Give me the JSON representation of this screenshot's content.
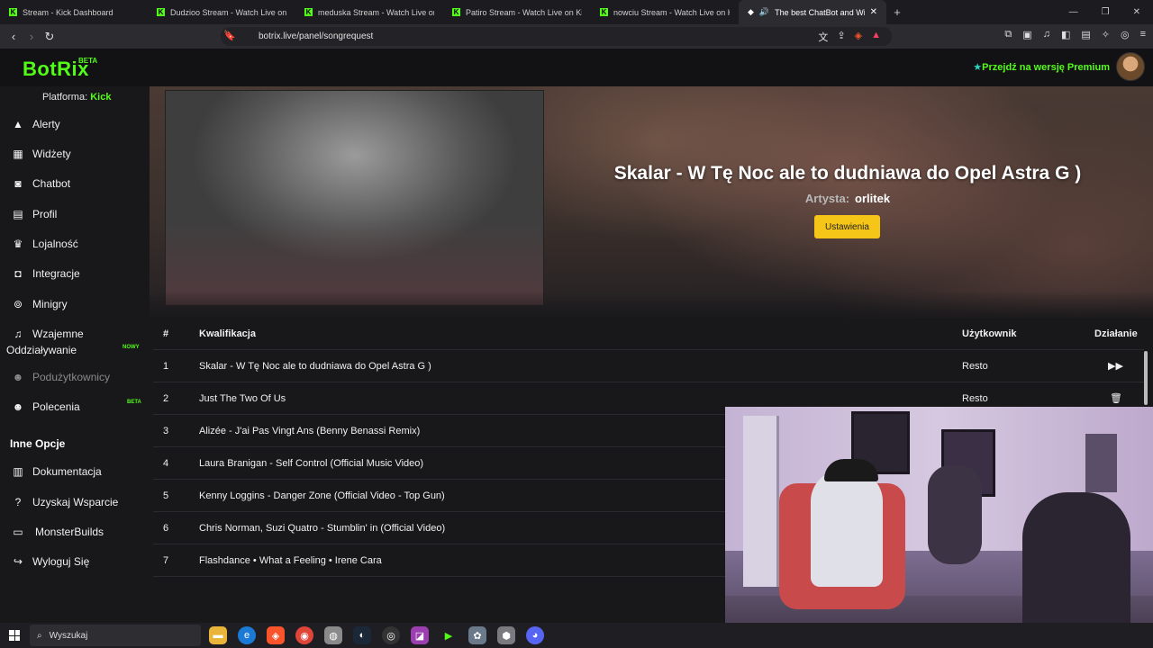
{
  "browser": {
    "tabs": [
      {
        "label": "Stream - Kick Dashboard",
        "kick": true
      },
      {
        "label": "Dudzioo Stream - Watch Live on Kick",
        "kick": true
      },
      {
        "label": "meduska Stream - Watch Live on Kick",
        "kick": true
      },
      {
        "label": "Patiro Stream - Watch Live on Kick",
        "kick": true
      },
      {
        "label": "nowciu Stream - Watch Live on Kick",
        "kick": true
      },
      {
        "label": "The best ChatBot and Widget",
        "kick": false,
        "active": true
      }
    ],
    "url": "botrix.live/panel/songrequest"
  },
  "header": {
    "logo": "BotRix",
    "logo_badge": "BETA",
    "premium_link": "Przejdź na wersję Premium",
    "brand_color": "#53fc18"
  },
  "sidebar": {
    "platform_label": "Platforma:",
    "platform_value": "Kick",
    "items": [
      {
        "label": "Alerty",
        "icon": "warning-icon"
      },
      {
        "label": "Widżety",
        "icon": "grid-icon"
      },
      {
        "label": "Chatbot",
        "icon": "robot-icon"
      },
      {
        "label": "Profil",
        "icon": "id-card-icon"
      },
      {
        "label": "Lojalność",
        "icon": "trophy-icon"
      },
      {
        "label": "Integracje",
        "icon": "plug-icon"
      },
      {
        "label": "Minigry",
        "icon": "gamepad-icon"
      },
      {
        "label": "Wzajemne",
        "label2": "Oddziaływanie",
        "icon": "music-icon",
        "badge": "NOWY"
      },
      {
        "label": "Podużytkownicy",
        "icon": "users-icon",
        "dim": true
      },
      {
        "label": "Polecenia",
        "icon": "users-icon",
        "badge": "BETA"
      }
    ],
    "section_label": "Inne Opcje",
    "other_items": [
      {
        "label": "Dokumentacja",
        "icon": "scroll-icon"
      },
      {
        "label": "Uzyskaj Wsparcie",
        "icon": "question-icon"
      },
      {
        "label": "MonsterBuilds",
        "icon": "laptop-icon"
      },
      {
        "label": "Wyloguj Się",
        "icon": "logout-icon"
      }
    ]
  },
  "now_playing": {
    "title": "Skalar - W Tę Noc ale to dudniawa do Opel Astra G )",
    "artist_label": "Artysta:",
    "artist": "orlitek",
    "settings_button": "Ustawienia"
  },
  "queue": {
    "headers": {
      "num": "#",
      "title": "Kwalifikacja",
      "user": "Użytkownik",
      "action": "Działanie"
    },
    "rows": [
      {
        "num": "1",
        "title": "Skalar - W Tę Noc ale to dudniawa do Opel Astra G )",
        "user": "Resto",
        "action": "skip"
      },
      {
        "num": "2",
        "title": "Just The Two Of Us",
        "user": "Resto",
        "action": "delete"
      },
      {
        "num": "3",
        "title": "Alizée - J'ai Pas Vingt Ans (Benny Benassi Remix)",
        "user": "",
        "action": ""
      },
      {
        "num": "4",
        "title": "Laura Branigan - Self Control (Official Music Video)",
        "user": "",
        "action": ""
      },
      {
        "num": "5",
        "title": "Kenny Loggins - Danger Zone (Official Video - Top Gun)",
        "user": "",
        "action": ""
      },
      {
        "num": "6",
        "title": "Chris Norman, Suzi Quatro - Stumblin' in (Official Video)",
        "user": "",
        "action": ""
      },
      {
        "num": "7",
        "title": "Flashdance • What a Feeling • Irene Cara",
        "user": "",
        "action": ""
      }
    ]
  },
  "taskbar": {
    "search_placeholder": "Wyszukaj"
  }
}
